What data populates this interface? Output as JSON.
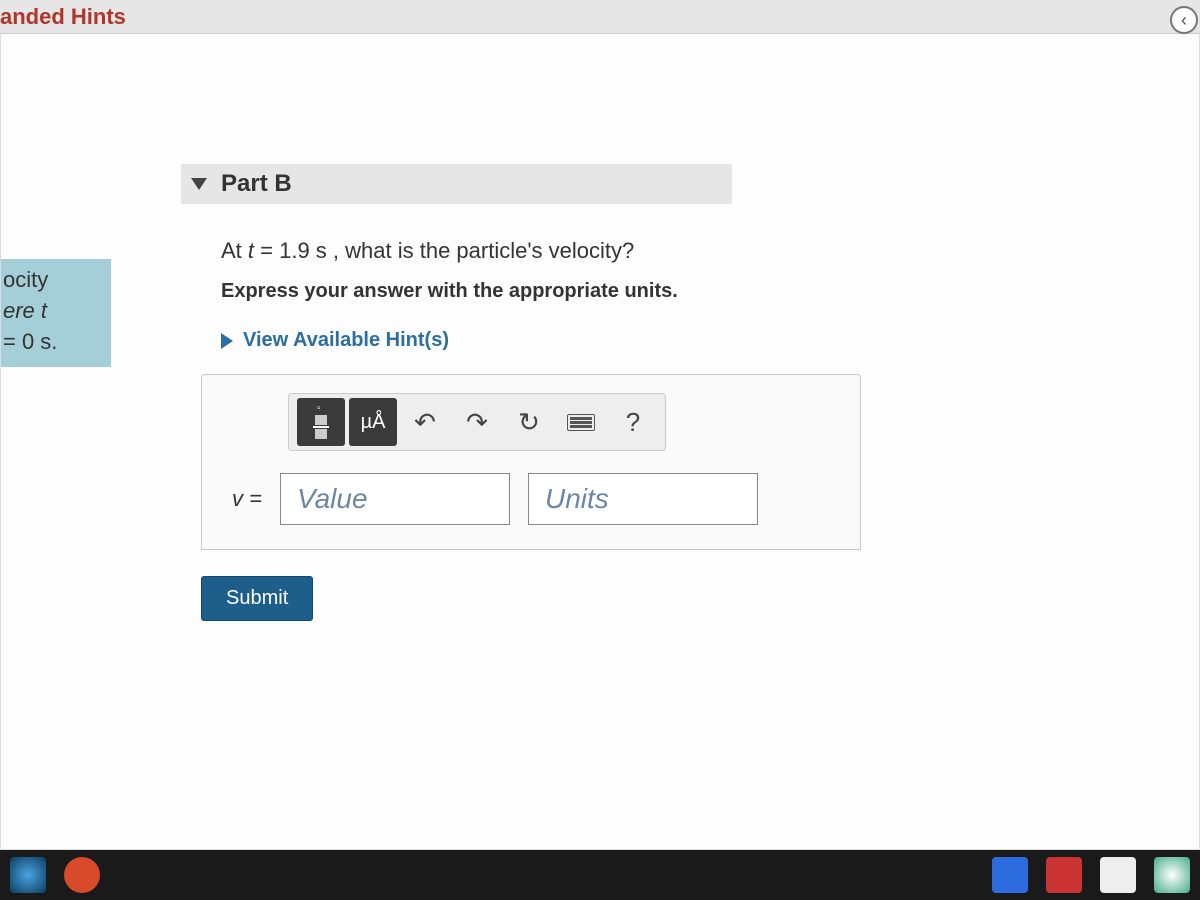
{
  "top": {
    "title_fragment": "anded Hints"
  },
  "left_snippet": {
    "line1": "ocity",
    "line2": "ere t",
    "line3": "= 0 s."
  },
  "part": {
    "label": "Part B"
  },
  "question": {
    "prefix": "At ",
    "var": "t",
    "equals": " = 1.9 s , ",
    "rest": "what is the particle's velocity?"
  },
  "instruction": "Express your answer with the appropriate units.",
  "hints_link": "View Available Hint(s)",
  "toolbar": {
    "units_symbol": "µÅ",
    "help": "?"
  },
  "answer": {
    "var_label": "v =",
    "value_placeholder": "Value",
    "units_placeholder": "Units"
  },
  "submit_label": "Submit"
}
